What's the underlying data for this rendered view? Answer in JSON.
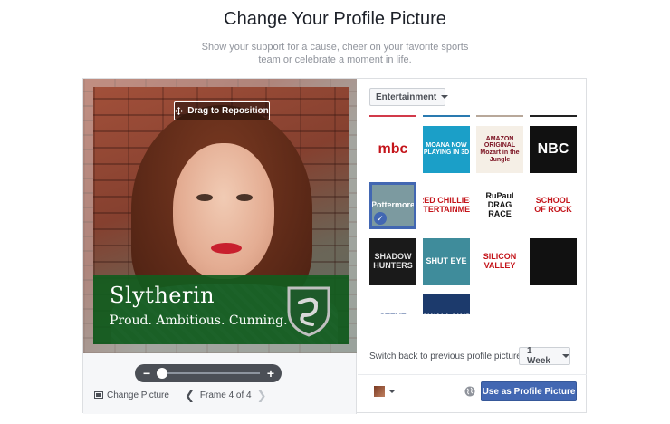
{
  "header": {
    "title": "Change Your Profile Picture",
    "subtitle": "Show your support for a cause, cheer on your favorite sports team or celebrate a moment in life."
  },
  "preview": {
    "drag_label": "Drag to Reposition",
    "frame_title": "Slytherin",
    "frame_motto": "Proud. Ambitious. Cunning.",
    "zoom_level": 0.05,
    "change_picture_label": "Change Picture",
    "frame_counter": "Frame 4 of 4"
  },
  "panel": {
    "category": "Entertainment",
    "switch_label": "Switch back to previous profile picture in",
    "duration": "1 Week",
    "use_button": "Use as Profile Picture",
    "accent": "#4267b2"
  },
  "frames": [
    {
      "label": "mbc",
      "bg": "#ffffff",
      "fg": "#c4141a",
      "selected": false
    },
    {
      "label": "MOANA NOW PLAYING IN 3D",
      "bg": "#1b9fc8",
      "fg": "#ffffff",
      "selected": false
    },
    {
      "label": "AMAZON ORIGINAL Mozart in the Jungle",
      "bg": "#f5efe6",
      "fg": "#7a1020",
      "selected": false
    },
    {
      "label": "NBC",
      "bg": "#111111",
      "fg": "#ffffff",
      "selected": false
    },
    {
      "label": "Pottermore",
      "bg": "#7c9aa0",
      "fg": "#ffffff",
      "selected": true
    },
    {
      "label": "RED CHILLIES ENTERTAINMENT",
      "bg": "#ffffff",
      "fg": "#c4141a",
      "selected": false
    },
    {
      "label": "RuPaul DRAG RACE",
      "bg": "#ffffff",
      "fg": "#111111",
      "selected": false
    },
    {
      "label": "SCHOOL OF ROCK",
      "bg": "#ffffff",
      "fg": "#c4141a",
      "selected": false
    },
    {
      "label": "SHADOW HUNTERS",
      "bg": "#1a1a1a",
      "fg": "#e4e4e4",
      "selected": false
    },
    {
      "label": "SHUT EYE",
      "bg": "#3f8c9b",
      "fg": "#ffffff",
      "selected": false
    },
    {
      "label": "SILICON VALLEY",
      "bg": "#ffffff",
      "fg": "#c4141a",
      "selected": false
    },
    {
      "label": "",
      "bg": "#111111",
      "fg": "#e4a400",
      "selected": false
    },
    {
      "label": "STEVE",
      "bg": "#ffffff",
      "fg": "#2c4c8c",
      "selected": false
    },
    {
      "label": "SWALLOWS",
      "bg": "#1c3a6c",
      "fg": "#ffffff",
      "selected": false
    },
    {
      "label": "",
      "bg": "#ffffff",
      "fg": "#e0288c",
      "selected": false
    },
    {
      "label": "",
      "bg": "#ffffff",
      "fg": "#c4141a",
      "selected": false
    }
  ],
  "top_strips": [
    "#d23a4a",
    "#2a7ab0",
    "#b8a89a",
    "#222222"
  ]
}
